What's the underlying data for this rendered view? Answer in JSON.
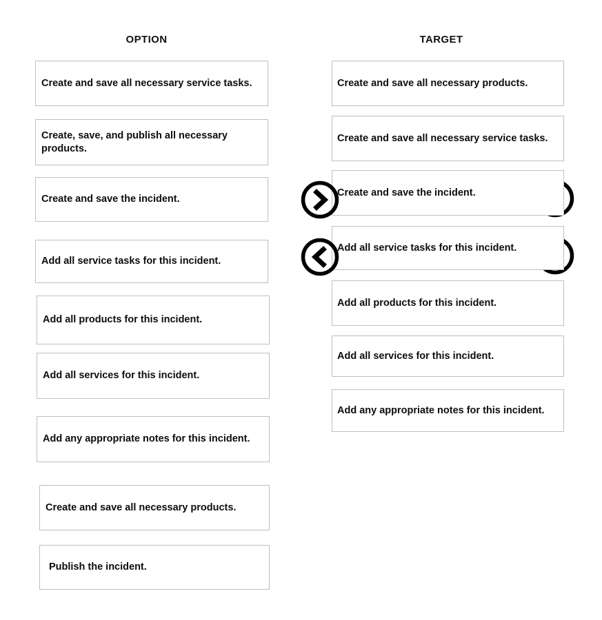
{
  "columns": {
    "option": {
      "header": "OPTION"
    },
    "target": {
      "header": "TARGET"
    }
  },
  "option_cards": [
    {
      "text": "Create and save all necessary service tasks."
    },
    {
      "text": "Create, save, and publish all necessary products."
    },
    {
      "text": "Create and save the incident."
    },
    {
      "text": "Add all service tasks for this incident."
    },
    {
      "text": "Add all products for this incident."
    },
    {
      "text": "Add all services for this incident."
    },
    {
      "text": "Add any appropriate notes for this incident."
    },
    {
      "text": "Create and save all necessary products."
    },
    {
      "text": "Publish the incident."
    }
  ],
  "target_cards": [
    {
      "text": "Create and save all necessary products."
    },
    {
      "text": "Create and save all necessary service tasks."
    },
    {
      "text": "Create and save the incident."
    },
    {
      "text": "Add all service tasks for this incident."
    },
    {
      "text": "Add all products for this incident."
    },
    {
      "text": "Add all services for this incident."
    },
    {
      "text": "Add any appropriate notes for this incident."
    }
  ],
  "markers": [
    {
      "icon": "chevron-right-circle-icon",
      "direction": "right",
      "side": "left",
      "attached_to_target_card": 2
    },
    {
      "icon": "circle-outline-icon",
      "direction": "none",
      "side": "right",
      "attached_to_target_card": 2
    },
    {
      "icon": "chevron-left-circle-icon",
      "direction": "left",
      "side": "left",
      "attached_to_target_card": 3
    },
    {
      "icon": "circle-outline-icon",
      "direction": "none",
      "side": "right",
      "attached_to_target_card": 3
    }
  ],
  "colors": {
    "page_background": "#ffffff",
    "card_background": "#ffffff",
    "card_border": "#bfbfbf",
    "text": "#0d0d0d",
    "marker_stroke": "#000000"
  }
}
